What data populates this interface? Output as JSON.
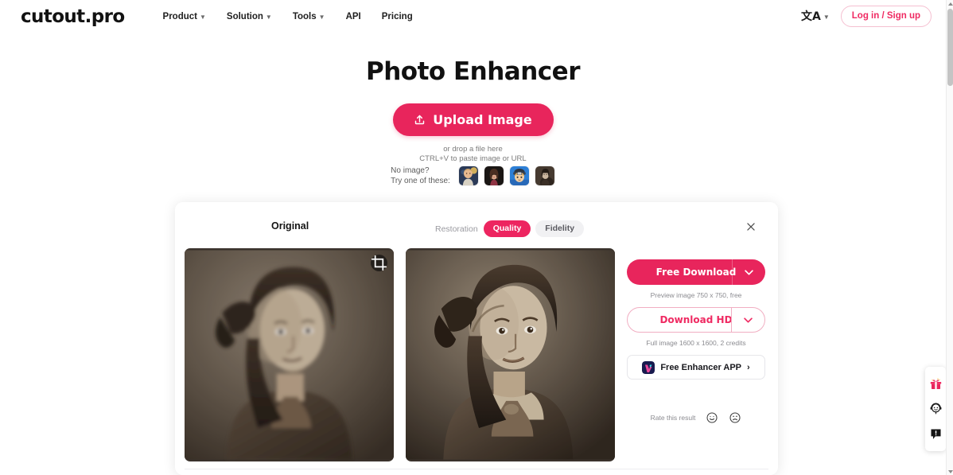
{
  "header": {
    "brand": "cutout.pro",
    "nav": [
      {
        "label": "Product",
        "caret": "chevron-down-icon",
        "has_caret": true
      },
      {
        "label": "Solution",
        "caret": "chevron-down-icon",
        "has_caret": true
      },
      {
        "label": "Tools",
        "caret": "chevron-down-icon",
        "has_caret": true
      },
      {
        "label": "API",
        "has_caret": false
      },
      {
        "label": "Pricing",
        "has_caret": false
      }
    ],
    "language": {
      "icon": "translate-icon",
      "glyph": "文A",
      "caret": "⌄"
    },
    "login_label": "Log in / Sign up"
  },
  "hero": {
    "title": "Photo Enhancer",
    "upload_label": "Upload Image",
    "upload_icon": "upload-icon",
    "drop_line_1": "or drop a file here",
    "drop_line_2": "CTRL+V to paste image or URL"
  },
  "samples": {
    "line_1": "No image?",
    "line_2": "Try one of these:",
    "thumbs": [
      {
        "name": "sample-thumb-child",
        "alt": "child portrait photo"
      },
      {
        "name": "sample-thumb-woman",
        "alt": "woman portrait photo"
      },
      {
        "name": "sample-thumb-anime",
        "alt": "anime character illustration"
      },
      {
        "name": "sample-thumb-vintage",
        "alt": "vintage sepia portrait"
      }
    ]
  },
  "result": {
    "original_label": "Original",
    "mode_label": "Restoration",
    "modes": [
      {
        "label": "Quality",
        "active": true
      },
      {
        "label": "Fidelity",
        "active": false
      }
    ],
    "close_icon": "close-icon",
    "crop_icon": "crop-icon",
    "original_image_alt": "Original vintage sepia portrait of a young girl with a hair bow",
    "enhanced_image_alt": "Enhanced vintage sepia portrait of a young girl with a hair bow",
    "free_download_label": "Free Download",
    "free_download_caret": "chevron-down-icon",
    "free_download_note": "Preview image 750 x 750, free",
    "download_hd_label": "Download HD",
    "download_hd_caret": "chevron-down-icon",
    "download_hd_note": "Full image 1600 x 1600, 2 credits",
    "app_label": "Free Enhancer APP",
    "app_arrow": "›",
    "app_icon": "enhancer-app-icon",
    "rate_label": "Rate this result",
    "rate_good_icon": "smiley-happy-icon",
    "rate_bad_icon": "smiley-sad-icon"
  },
  "rail": [
    {
      "name": "gift-icon",
      "title": "gift"
    },
    {
      "name": "customer-service-icon",
      "title": "support"
    },
    {
      "name": "feedback-icon",
      "title": "feedback"
    }
  ],
  "scrollbar": {
    "up": "▴",
    "down": "▾"
  },
  "colors": {
    "brand_pink": "#e8255c",
    "accent_pink": "#ed2560",
    "pill_idle_bg": "#f1f1f3",
    "text_dark": "#111111",
    "text_muted": "#8b8b90"
  }
}
